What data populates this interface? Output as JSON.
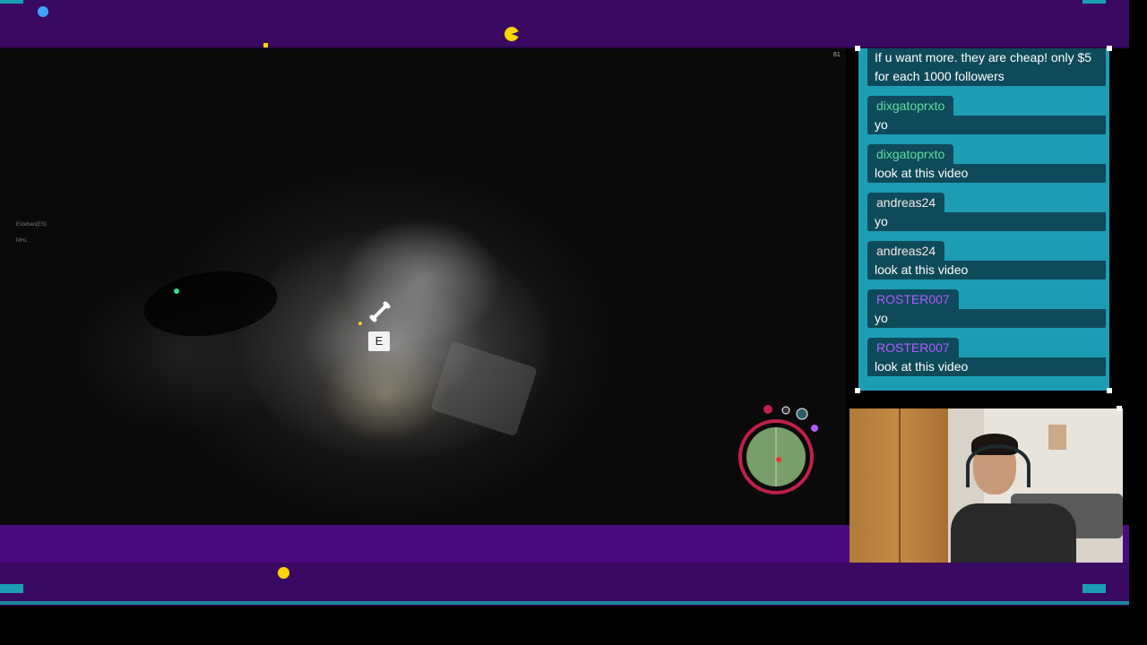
{
  "chat": {
    "messages": [
      {
        "user": "",
        "text_line1": "If u want more. they are cheap! only $5",
        "text_line2": "for each 1000 followers",
        "color": "#ffffff"
      },
      {
        "user": "dixgatoprxto",
        "text": "yo",
        "color": "#5ee0a2"
      },
      {
        "user": "dixgatoprxto",
        "text": "look at this video",
        "color": "#5ee0a2"
      },
      {
        "user": "andreas24",
        "text": "yo",
        "color": "#f4e8e8"
      },
      {
        "user": "andreas24",
        "text": "look at this video",
        "color": "#f4e8e8"
      },
      {
        "user": "ROSTER007",
        "text": "yo",
        "color": "#b05cff"
      },
      {
        "user": "ROSTER007",
        "text": "look at this video",
        "color": "#b05cff"
      }
    ]
  },
  "game": {
    "interact_key": "E",
    "fps": "61",
    "hud_names": [
      "Esteban(ES)",
      "MHL"
    ],
    "icons": [
      "bone-icon",
      "minimap-icon",
      "compass-icon"
    ]
  },
  "overlay": {
    "accent": "#1c9db4",
    "band_color": "#3a0a63",
    "pacman_color": "#ffd700"
  }
}
